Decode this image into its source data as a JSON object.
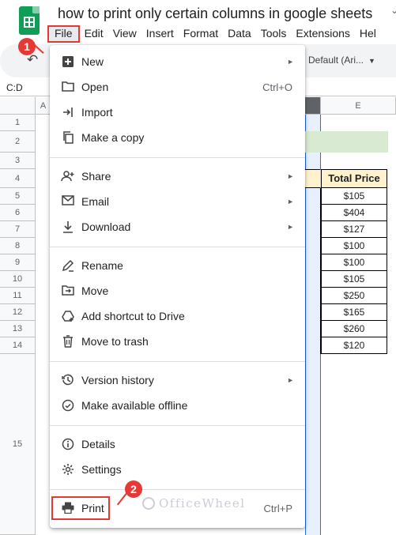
{
  "app": {
    "title": "how to print only certain columns in google sheets",
    "menubar": [
      "File",
      "Edit",
      "View",
      "Insert",
      "Format",
      "Data",
      "Tools",
      "Extensions",
      "Hel"
    ],
    "font_select": "Default (Ari...",
    "name_box": "C:D"
  },
  "sheet": {
    "columns": [
      "A",
      "E"
    ],
    "rows": [
      "1",
      "2",
      "3",
      "4",
      "5",
      "6",
      "7",
      "8",
      "9",
      "10",
      "11",
      "12",
      "13",
      "14",
      "15"
    ],
    "header_cell": "Total Price",
    "total_prices": [
      "$105",
      "$404",
      "$127",
      "$100",
      "$100",
      "$105",
      "$250",
      "$165",
      "$260",
      "$120"
    ]
  },
  "file_menu": {
    "items": [
      {
        "label": "New",
        "icon": "plus-box-icon",
        "submenu": true
      },
      {
        "label": "Open",
        "icon": "folder-icon",
        "shortcut": "Ctrl+O"
      },
      {
        "label": "Import",
        "icon": "import-arrow-icon"
      },
      {
        "label": "Make a copy",
        "icon": "copy-icon"
      },
      {
        "label": "Share",
        "icon": "add-person-icon",
        "submenu": true
      },
      {
        "label": "Email",
        "icon": "mail-icon",
        "submenu": true
      },
      {
        "label": "Download",
        "icon": "download-icon",
        "submenu": true
      },
      {
        "label": "Rename",
        "icon": "pencil-icon"
      },
      {
        "label": "Move",
        "icon": "move-folder-icon"
      },
      {
        "label": "Add shortcut to Drive",
        "icon": "drive-shortcut-icon"
      },
      {
        "label": "Move to trash",
        "icon": "trash-icon"
      },
      {
        "label": "Version history",
        "icon": "history-icon",
        "submenu": true
      },
      {
        "label": "Make available offline",
        "icon": "offline-check-icon"
      },
      {
        "label": "Details",
        "icon": "info-icon"
      },
      {
        "label": "Settings",
        "icon": "gear-icon"
      },
      {
        "label": "Print",
        "icon": "printer-icon",
        "shortcut": "Ctrl+P"
      }
    ]
  },
  "annotations": {
    "step1": "1",
    "step2": "2"
  },
  "watermark": "OfficeWheel",
  "colors": {
    "accent_red": "#e53935",
    "sheets_green": "#0f9d58",
    "selection_blue": "#1a73e8"
  }
}
